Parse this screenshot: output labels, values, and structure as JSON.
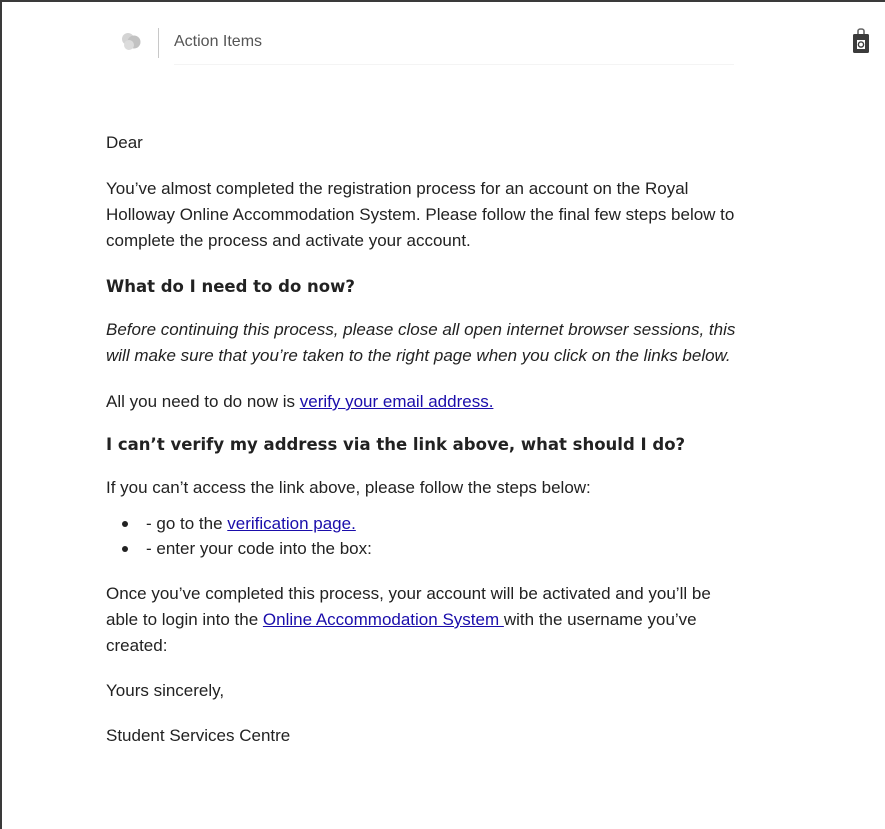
{
  "header": {
    "title": "Action Items",
    "logo_icon": "app-logo-icon",
    "bag_icon": "office-bag-icon"
  },
  "email": {
    "greeting": "Dear",
    "intro_lines": [
      "You’ve almost completed the registration process for an account on the Royal",
      "Holloway Online Accommodation System. Please follow the final few steps below to",
      "complete the process and activate your account."
    ],
    "heading_1": "What do I need to do now?",
    "italic_lines": [
      "Before continuing this process, please close all open internet browser sessions, this",
      "will make sure that you’re taken to the right page when you click on the links below."
    ],
    "action": {
      "prefix": "All you need to do now is ",
      "link": "verify your email address."
    },
    "heading_2": "I can’t verify my address via the link above, what should I do?",
    "steps_intro": "If you can’t access the link above, please follow the steps below:",
    "steps": [
      {
        "prefix": "- go to the ",
        "link": "verification page.",
        "suffix": ""
      },
      {
        "prefix": "- enter your code into the box:",
        "link": "",
        "suffix": ""
      }
    ],
    "outro": {
      "line_1": "Once you’ve completed this process, your account will be activated and you’ll be",
      "line_2_prefix": "able to login into the ",
      "line_2_link": "Online Accommodation System ",
      "line_2_suffix": "with the username you’ve",
      "line_3": "created:"
    },
    "signoff": "Yours sincerely,",
    "signature": "Student Services Centre"
  },
  "colors": {
    "link": "#1a0dab",
    "text": "#222222",
    "header_text": "#555555"
  }
}
